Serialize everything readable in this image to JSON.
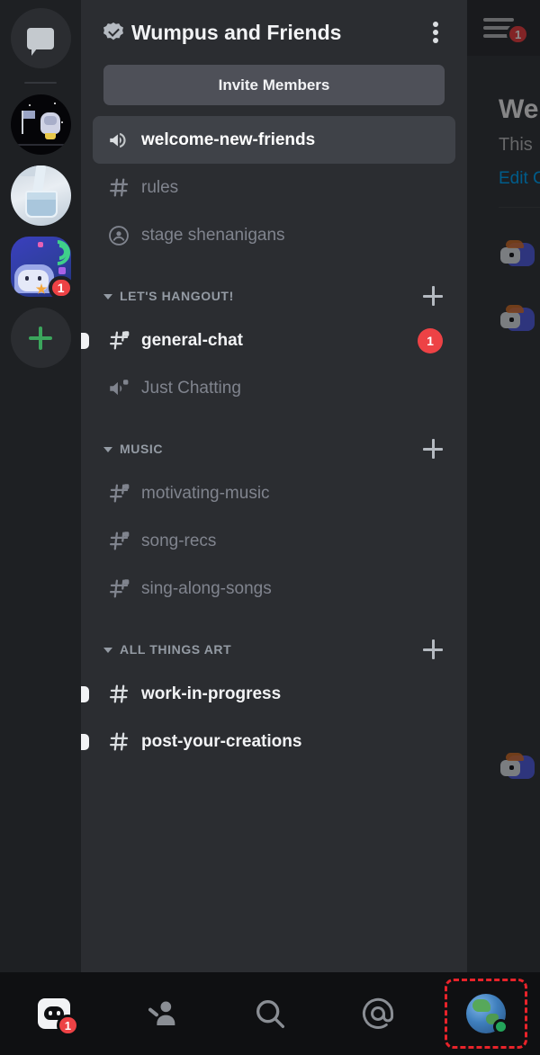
{
  "content_panel": {
    "menu_badge": "1",
    "welcome_title": "We",
    "welcome_sub": "This",
    "edit_link": "Edit C"
  },
  "server_rail": {
    "dm_button_label": "direct-messages",
    "servers": [
      {
        "name": "moon-wumpus-server",
        "badge": ""
      },
      {
        "name": "water-glass-server",
        "badge": ""
      },
      {
        "name": "wumpus-wifi-server",
        "badge": "1"
      }
    ],
    "add_server_label": "add-a-server"
  },
  "drawer": {
    "server_name": "Wumpus and Friends",
    "verified": true,
    "invite_label": "Invite Members",
    "top_channels": [
      {
        "name": "welcome-new-friends",
        "icon": "announcement",
        "state": "selected",
        "badge": ""
      },
      {
        "name": "rules",
        "icon": "hash",
        "state": "muted",
        "badge": ""
      },
      {
        "name": "stage shenanigans",
        "icon": "stage",
        "state": "muted",
        "badge": ""
      }
    ],
    "categories": [
      {
        "label": "LET'S HANGOUT!",
        "channels": [
          {
            "name": "general-chat",
            "icon": "hash-voice",
            "state": "unread",
            "badge": "1"
          },
          {
            "name": "Just Chatting",
            "icon": "voice",
            "state": "muted",
            "badge": ""
          }
        ]
      },
      {
        "label": "MUSIC",
        "channels": [
          {
            "name": "motivating-music",
            "icon": "hash-voice",
            "state": "muted",
            "badge": ""
          },
          {
            "name": "song-recs",
            "icon": "hash-voice",
            "state": "muted",
            "badge": ""
          },
          {
            "name": "sing-along-songs",
            "icon": "hash-voice",
            "state": "muted",
            "badge": ""
          }
        ]
      },
      {
        "label": "ALL THINGS ART",
        "channels": [
          {
            "name": "work-in-progress",
            "icon": "hash",
            "state": "unread",
            "badge": ""
          },
          {
            "name": "post-your-creations",
            "icon": "hash",
            "state": "unread",
            "badge": ""
          }
        ]
      }
    ]
  },
  "bottom_nav": {
    "items": [
      {
        "name": "servers-tab",
        "icon": "discord-logo-icon",
        "badge": "1",
        "selected": false
      },
      {
        "name": "friends-tab",
        "icon": "friends-icon",
        "badge": "",
        "selected": false
      },
      {
        "name": "search-tab",
        "icon": "search-icon",
        "badge": "",
        "selected": false
      },
      {
        "name": "mentions-tab",
        "icon": "mention-icon",
        "badge": "",
        "selected": false
      },
      {
        "name": "profile-tab",
        "icon": "avatar-icon",
        "badge": "",
        "selected": true
      }
    ]
  },
  "colors": {
    "rail_bg": "#1e2023",
    "drawer_bg": "#2b2d31",
    "content_bg": "#36393f",
    "selected_channel_bg": "#3f4248",
    "badge_red": "#ed4245",
    "online_green": "#23a55a",
    "link_blue": "#00a8fc",
    "selection_outline": "#e8232a"
  }
}
